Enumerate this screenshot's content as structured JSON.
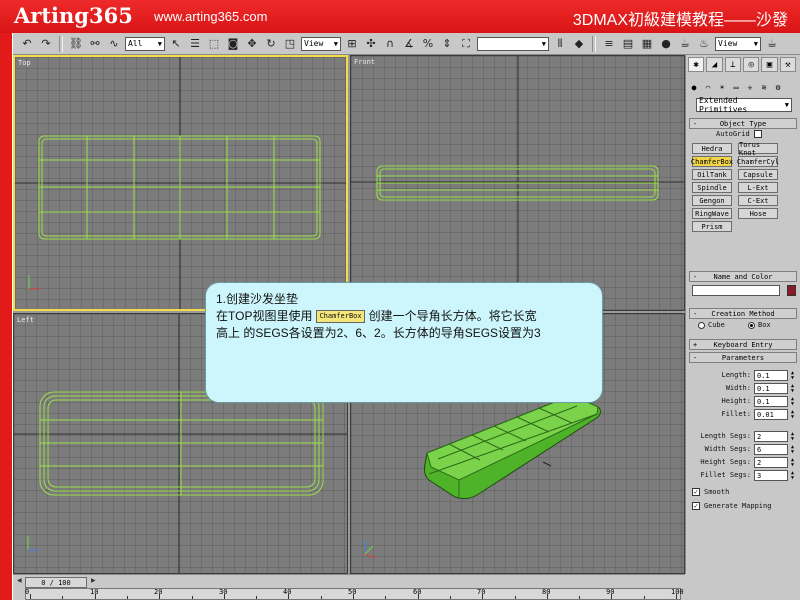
{
  "banner": {
    "logo": "Arting365",
    "url": "www.arting365.com",
    "course": "3DMAX初級建模教程——沙發"
  },
  "toolbar": {
    "selection_filter": "All",
    "ref_coord": "View",
    "named_selection": "",
    "render_view": "View"
  },
  "viewports": {
    "top": "Top",
    "front": "Front",
    "left": "Left",
    "perspective": ""
  },
  "callout": {
    "line1": "1.创建沙发坐垫",
    "line2_prefix": "在TOP视图里使用",
    "line2_chip": "ChamferBox",
    "line2_suffix": "创建一个导角长方体。将它长宽",
    "line3": "高上 的SEGS各设置为2、6、2。长方体的导角SEGS设置为3"
  },
  "panel": {
    "category": "Extended Primitives",
    "object_type_header": "Object Type",
    "autogrid": "AutoGrid",
    "buttons": [
      "Hedra",
      "Torus Knot",
      "ChamferBox",
      "ChamferCyl",
      "OilTank",
      "Capsule",
      "Spindle",
      "L-Ext",
      "Gengon",
      "C-Ext",
      "RingWave",
      "Hose",
      "Prism"
    ],
    "selected_button": "ChamferBox",
    "name_color_header": "Name and Color",
    "object_color": "#8a1a2a",
    "creation_method_header": "Creation Method",
    "creation_cube": "Cube",
    "creation_box": "Box",
    "keyboard_entry_header": "Keyboard Entry",
    "parameters_header": "Parameters",
    "params": [
      {
        "label": "Length:",
        "value": "0.1"
      },
      {
        "label": "Width:",
        "value": "0.1"
      },
      {
        "label": "Height:",
        "value": "0.1"
      },
      {
        "label": "Fillet:",
        "value": "0.01"
      }
    ],
    "segs": [
      {
        "label": "Length Segs:",
        "value": "2"
      },
      {
        "label": "Width Segs:",
        "value": "6"
      },
      {
        "label": "Height Segs:",
        "value": "2"
      },
      {
        "label": "Fillet Segs:",
        "value": "3"
      }
    ],
    "smooth": "Smooth",
    "generate_mapping": "Generate Mapping"
  },
  "timeline": {
    "frame_display": "0 / 100",
    "ticks": [
      "0",
      "10",
      "20",
      "30",
      "40",
      "50",
      "60",
      "70",
      "80",
      "90",
      "100"
    ]
  },
  "colors": {
    "banner_red": "#e21a1a",
    "wireframe": "#9be04a",
    "callout_bg": "#ccf6fb",
    "active_viewport": "#f3dc4a"
  }
}
